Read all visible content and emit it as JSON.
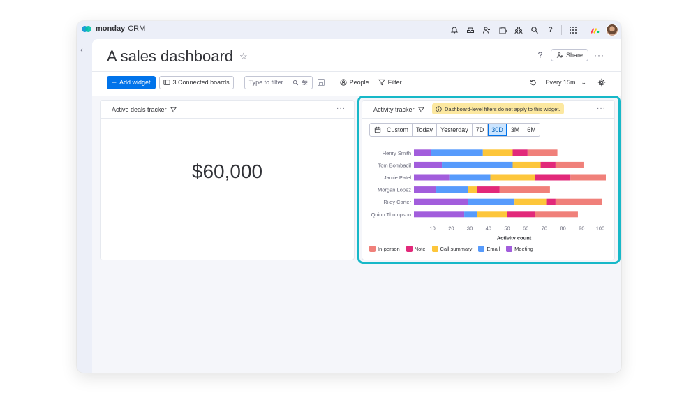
{
  "app": {
    "brand": "monday",
    "product": "CRM"
  },
  "page": {
    "title": "A sales dashboard",
    "share_label": "Share",
    "help": "?"
  },
  "toolbar": {
    "add_widget": "Add widget",
    "connected_boards": "3 Connected boards",
    "filter_placeholder": "Type to filter",
    "people": "People",
    "filter": "Filter",
    "refresh": "Every 15m"
  },
  "widgets": {
    "deals": {
      "title": "Active deals tracker",
      "value": "$60,000"
    },
    "activity": {
      "title": "Activity tracker",
      "notice": "Dashboard-level filters do not apply to this widget.",
      "ranges": [
        {
          "label": "Custom",
          "active": false
        },
        {
          "label": "Today",
          "active": false
        },
        {
          "label": "Yesterday",
          "active": false
        },
        {
          "label": "7D",
          "active": false
        },
        {
          "label": "30D",
          "active": true
        },
        {
          "label": "3M",
          "active": false
        },
        {
          "label": "6M",
          "active": false
        }
      ]
    }
  },
  "chart_data": {
    "type": "bar",
    "orientation": "horizontal",
    "stacked": true,
    "categories": [
      "Henry Smith",
      "Tom Bombadil",
      "Jamie Patel",
      "Morgan Lopez",
      "Riley Carter",
      "Quinn Thompson"
    ],
    "xlabel": "Activity count",
    "xlim": [
      0,
      103
    ],
    "xticks": [
      10,
      20,
      30,
      40,
      50,
      60,
      70,
      80,
      90,
      100
    ],
    "series": [
      {
        "name": "Meeting",
        "color": "#a25ddc",
        "values": [
          9,
          15,
          19,
          12,
          29,
          27
        ]
      },
      {
        "name": "Email",
        "color": "#579bfc",
        "values": [
          28,
          38,
          22,
          17,
          25,
          7
        ]
      },
      {
        "name": "Call summary",
        "color": "#fdc63b",
        "values": [
          16,
          15,
          24,
          5,
          17,
          16
        ]
      },
      {
        "name": "Note",
        "color": "#e2297a",
        "values": [
          8,
          8,
          19,
          12,
          5,
          15
        ]
      },
      {
        "name": "In-person",
        "color": "#f0807a",
        "values": [
          16,
          15,
          19,
          27,
          25,
          23
        ]
      }
    ],
    "legend_order": [
      "In-person",
      "Note",
      "Call summary",
      "Email",
      "Meeting"
    ],
    "legend_position": "bottom"
  }
}
